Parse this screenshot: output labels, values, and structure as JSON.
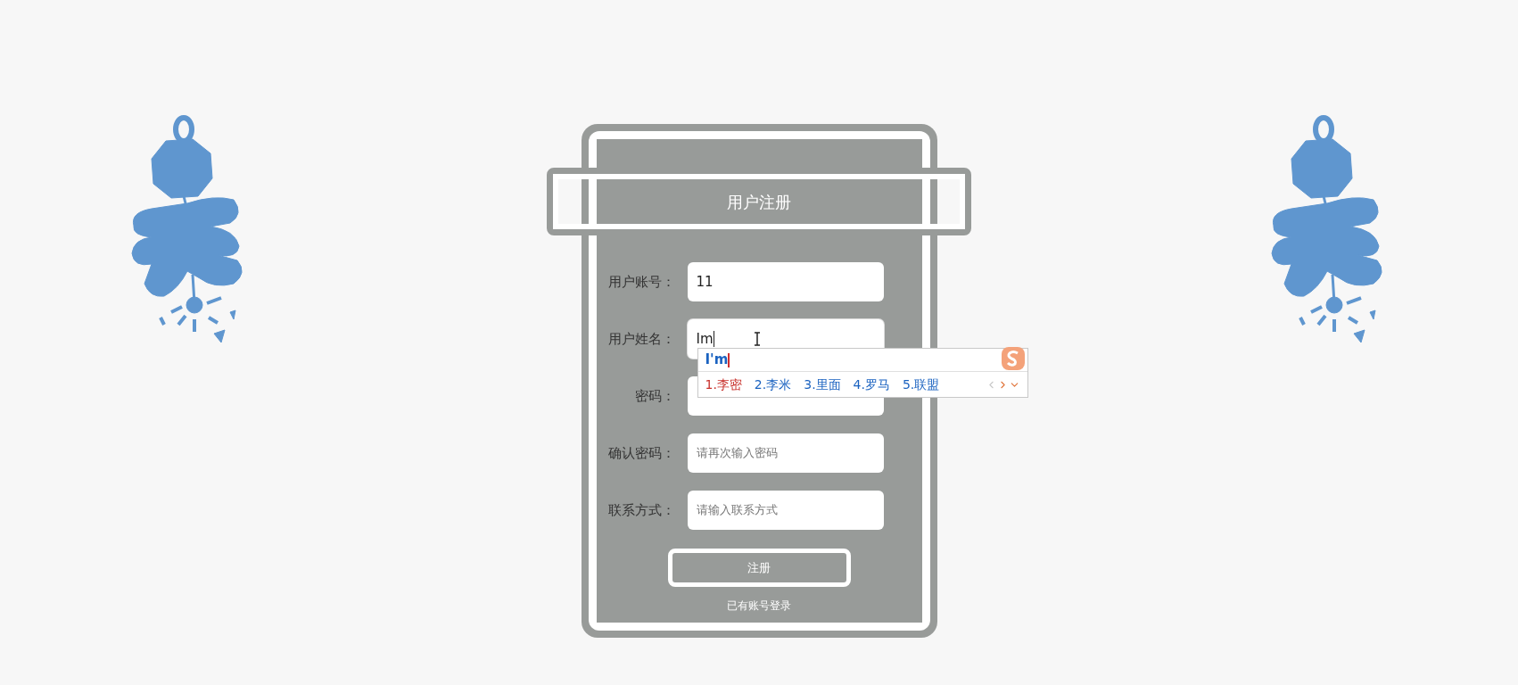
{
  "title": "用户注册",
  "fields": [
    {
      "label": "用户账号：",
      "value": "11"
    },
    {
      "label": "用户姓名：",
      "value": "Im",
      "focused": true
    },
    {
      "label": "密码："
    },
    {
      "label": "确认密码：",
      "placeholder": "请再次输入密码"
    },
    {
      "label": "联系方式：",
      "placeholder": "请输入联系方式"
    }
  ],
  "ime": {
    "composition": "I'm",
    "candidates": [
      {
        "text": "1.李密",
        "selected": true
      },
      {
        "text": "2.李米",
        "selected": false
      },
      {
        "text": "3.里面",
        "selected": false
      },
      {
        "text": "4.罗马",
        "selected": false
      },
      {
        "text": "5.联盟",
        "selected": false
      }
    ]
  },
  "submit": "注册",
  "login_link": "已有账号登录"
}
